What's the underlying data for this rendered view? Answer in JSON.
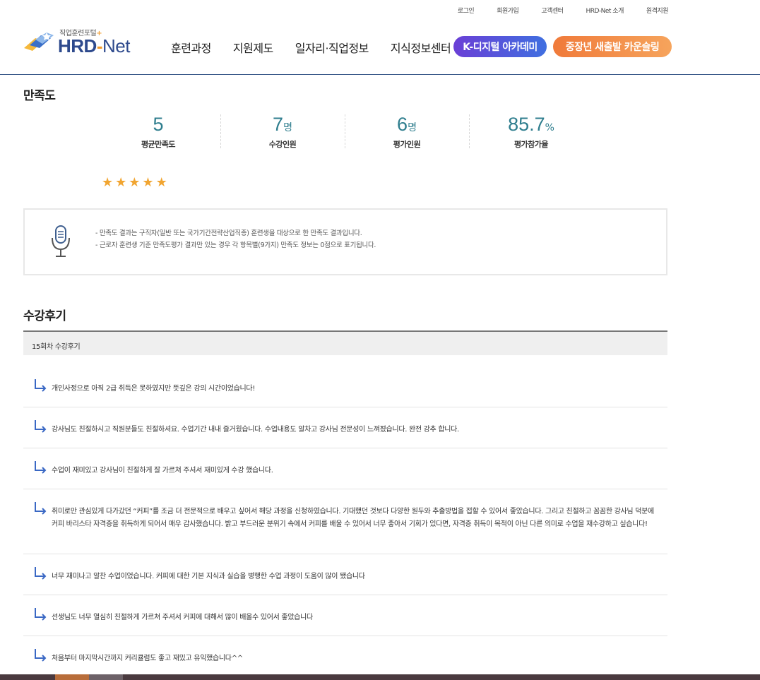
{
  "util_links": [
    "로그인",
    "회원가입",
    "고객센터",
    "HRD-Net 소개",
    "원격지원"
  ],
  "logo": {
    "sub": "직업훈련포털",
    "plus": "+",
    "main_hrd": "HRD",
    "main_dash": "-",
    "main_net": "Net"
  },
  "nav": {
    "menus": [
      "훈련과정",
      "지원제도",
      "일자리·직업정보",
      "지식정보센터"
    ],
    "k_digital": "K-디지털 아카데미",
    "counseling": "중장년 새출발 카운슬링"
  },
  "satisfaction": {
    "title": "만족도",
    "stats": [
      {
        "num": "5",
        "unit": "",
        "label": "평균만족도"
      },
      {
        "num": "7",
        "unit": "명",
        "label": "수강인원"
      },
      {
        "num": "6",
        "unit": "명",
        "label": "평가인원"
      },
      {
        "num": "85.7",
        "unit": "%",
        "label": "평가참가율"
      }
    ],
    "stars": 5,
    "notice": [
      "- 만족도 결과는 구직자(일반 또는 국가기간전략산업직종) 훈련생을 대상으로 한 만족도 결과입니다.",
      "- 근로자 훈련생 기준 만족도평가 결과만 있는 경우 각 항목별(9가지) 만족도 정보는 0점으로 표기됩니다."
    ]
  },
  "reviews_section": {
    "title": "수강후기",
    "head": "15회차 수강후기",
    "items": [
      "개인사정으로 아직 2급 취득은 못하였지만 뜻깊은 강의 시간이었습니다!",
      "강사님도 친절하시고 직원분들도 친절하셔요. 수업기간 내내 즐거웠습니다. 수업내용도 알차고 강사님 전문성이 느껴졌습니다. 완전 강추 합니다.",
      "수업이 재미있고 강사님이 친절하게 잘 가르쳐 주셔서 재미있게 수강 했습니다.",
      "취미로만 관심있게 다가갔던 “커피”를 조금 더 전문적으로 배우고 싶어서 해당 과정을 신청하였습니다. 기대했던 것보다 다양한 원두와 추출방법을 접할 수 있어서 좋았습니다. 그리고 친절하고 꼼꼼한 강사님 덕분에 커피 바리스타 자격증을 취득하게 되어서 매우 감사했습니다. 밝고 부드러운 분위기 속에서 커피를 배울 수 있어서 너무 좋아서 기회가 있다면, 자격증 취득이 목적이 아닌 다른 의미로 수업을 재수강하고 싶습니다!",
      "너무 재미나고 알찬 수업이었습니다. 커피에 대한 기본 지식과 실습을 병행한 수업 과정이 도움이 많이 됐습니다",
      "선생님도 너무 열심히 친절하게 가르쳐 주셔서 커피에 대해서 많이 배울수 있어서 좋았습니다",
      "처음부터 마지막시간까지 커리큘럼도 좋고 재밌고 유익했습니다^^"
    ]
  },
  "colors": {
    "accent": "#2f7e8e",
    "star": "#f1a531",
    "k_pill": "#5a4fdb",
    "counsel_pill": "#f28a44",
    "arrow": "#3a68c4"
  }
}
